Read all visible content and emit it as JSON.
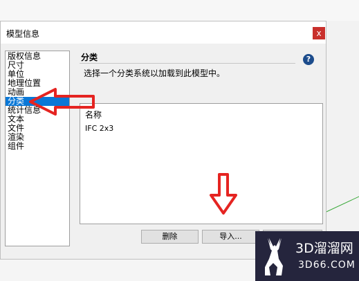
{
  "dialog": {
    "title": "模型信息",
    "close_glyph": "x"
  },
  "nav": {
    "items": [
      {
        "label": "版权信息"
      },
      {
        "label": "尺寸"
      },
      {
        "label": "单位"
      },
      {
        "label": "地理位置"
      },
      {
        "label": "动画"
      },
      {
        "label": "分类",
        "selected": true
      },
      {
        "label": "统计信息"
      },
      {
        "label": "文本"
      },
      {
        "label": "文件"
      },
      {
        "label": "渲染"
      },
      {
        "label": "组件"
      }
    ]
  },
  "section": {
    "title": "分类",
    "help_glyph": "?",
    "description": "选择一个分类系统以加载到此模型中。"
  },
  "classifications": {
    "column_header": "名称",
    "rows": [
      "IFC 2x3"
    ]
  },
  "buttons": {
    "delete": "删除",
    "import": "导入..."
  },
  "watermark": {
    "title": "3D溜溜网",
    "subtitle": "3D66.COM"
  },
  "colors": {
    "selection": "#0a78d7",
    "close": "#c9302c",
    "annotation": "#e52421",
    "help": "#1c4c8c",
    "watermark_bg": "#25253d"
  },
  "icons": {
    "help": "help-circle-icon",
    "close": "close-icon",
    "watermark_logo": "deer-icon"
  }
}
